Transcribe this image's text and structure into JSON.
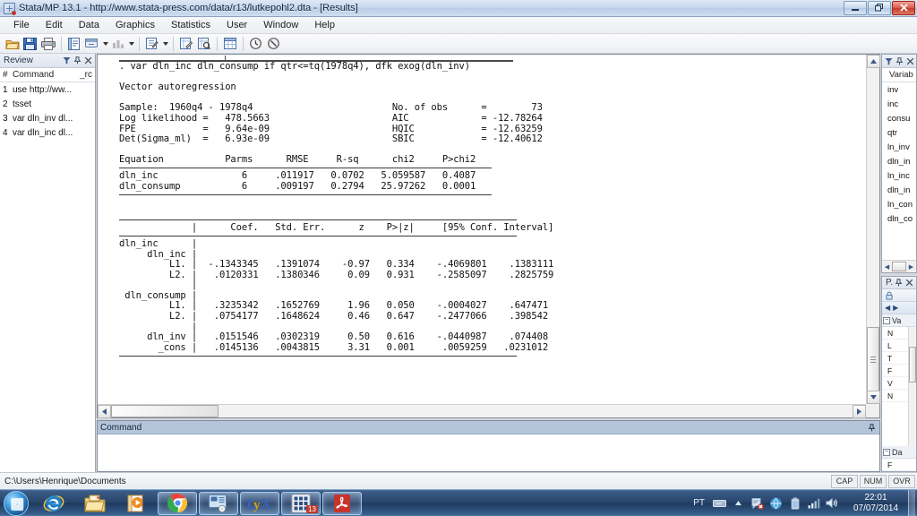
{
  "window": {
    "title": "Stata/MP 13.1 - http://www.stata-press.com/data/r13/lutkepohl2.dta - [Results]",
    "minimize_label": "–",
    "restore_label": "❐",
    "close_label": "✕"
  },
  "menu": {
    "items": [
      {
        "label": "File"
      },
      {
        "label": "Edit"
      },
      {
        "label": "Data"
      },
      {
        "label": "Graphics"
      },
      {
        "label": "Statistics"
      },
      {
        "label": "User"
      },
      {
        "label": "Window"
      },
      {
        "label": "Help"
      }
    ]
  },
  "toolbar": {
    "buttons": [
      {
        "name": "open-icon",
        "title": "Open"
      },
      {
        "name": "save-icon",
        "title": "Save"
      },
      {
        "name": "print-icon",
        "title": "Print"
      },
      {
        "name": "log-icon",
        "title": "Begin log"
      },
      {
        "name": "viewer-icon",
        "title": "Viewer"
      },
      {
        "name": "graph-icon",
        "title": "Bring graph window to front"
      },
      {
        "name": "do-editor-icon",
        "title": "New Do-file Editor"
      },
      {
        "name": "data-editor-icon",
        "title": "Data Editor (Edit)"
      },
      {
        "name": "data-browser-icon",
        "title": "Data Editor (Browse)"
      },
      {
        "name": "variables-manager-icon",
        "title": "Variables Manager"
      },
      {
        "name": "clock-icon",
        "title": "More"
      },
      {
        "name": "break-icon",
        "title": "Break"
      }
    ]
  },
  "review": {
    "title": "Review",
    "columns": {
      "num": "#",
      "command": "Command",
      "rc": "_rc"
    },
    "rows": [
      {
        "num": "1",
        "command": "use http://ww..."
      },
      {
        "num": "2",
        "command": "tsset"
      },
      {
        "num": "3",
        "command": "var dln_inv dl..."
      },
      {
        "num": "4",
        "command": "var dln_inc dl..."
      }
    ],
    "header_icons": [
      "filter-icon",
      "pin-icon",
      "close-icon"
    ]
  },
  "variables": {
    "title": "Variab",
    "column_header": "Variab",
    "items": [
      {
        "name": "inv"
      },
      {
        "name": "inc"
      },
      {
        "name": "consu"
      },
      {
        "name": "qtr"
      },
      {
        "name": "ln_inv"
      },
      {
        "name": "dln_in"
      },
      {
        "name": "ln_inc"
      },
      {
        "name": "dln_in"
      },
      {
        "name": "ln_con"
      },
      {
        "name": "dln_co"
      }
    ],
    "header_icons": [
      "filter-icon",
      "pin-icon",
      "close-icon"
    ]
  },
  "properties": {
    "title": "P...",
    "lock_icon": "lock-icon",
    "nav_back": "◀",
    "nav_forward": "▶",
    "groups": [
      {
        "label": "Va",
        "rows": [
          {
            "label": "N"
          },
          {
            "label": "L"
          },
          {
            "label": "T"
          },
          {
            "label": "F"
          },
          {
            "label": "V"
          },
          {
            "label": "N"
          }
        ]
      },
      {
        "label": "Da",
        "rows": [
          {
            "label": "F"
          }
        ]
      }
    ],
    "header_icons": [
      "pin-icon",
      "close-icon"
    ]
  },
  "command_window": {
    "title": "Command",
    "value": "",
    "placeholder": "",
    "pin_icon": "pin-icon"
  },
  "results": {
    "lines": [
      ". var dln_inc dln_consump if qtr<=tq(1978q4), dfk exog(dln_inv)",
      "",
      "Vector autoregression",
      "",
      "Sample:  1960q4 - 1978q4                         No. of obs      =        73",
      "Log likelihood =   478.5663                      AIC             = -12.78264",
      "FPE            =   9.64e-09                      HQIC            = -12.63259",
      "Det(Sigma_ml)  =   6.93e-09                      SBIC            = -12.40612",
      "",
      "Equation           Parms      RMSE     R-sq      chi2     P>chi2",
      "RULE_EQ_TOP",
      "dln_inc               6     .011917   0.0702   5.059587   0.4087",
      "dln_consump           6     .009197   0.2794   25.97262   0.0001",
      "RULE_EQ_BOT",
      "",
      "",
      "RULE_COEF_TOP",
      "             |      Coef.   Std. Err.      z    P>|z|     [95% Conf. Interval]",
      "RULE_COEF_MID",
      "dln_inc      |",
      "     dln_inc |",
      "         L1. |  -.1343345   .1391074    -0.97   0.334    -.4069801    .1383111",
      "         L2. |   .0120331   .1380346     0.09   0.931    -.2585097    .2825759",
      "             |",
      " dln_consump |",
      "         L1. |   .3235342   .1652769     1.96   0.050    -.0004027    .647471",
      "         L2. |   .0754177   .1648624     0.46   0.647    -.2477066    .398542",
      "             |",
      "     dln_inv |   .0151546   .0302319     0.50   0.616    -.0440987    .074408",
      "       _cons |   .0145136   .0043815     3.31   0.001     .0059259   .0231012",
      "RULE_COEF_BOT"
    ]
  },
  "statusbar": {
    "path": "C:\\Users\\Henrique\\Documents",
    "indicators": [
      {
        "label": "CAP"
      },
      {
        "label": "NUM"
      },
      {
        "label": "OVR"
      }
    ]
  },
  "taskbar": {
    "start_label": "Start",
    "tasks": [
      {
        "name": "internet-explorer-icon",
        "open": false
      },
      {
        "name": "file-explorer-icon",
        "open": false
      },
      {
        "name": "windows-media-player-icon",
        "open": false
      },
      {
        "name": "google-chrome-icon",
        "open": true
      },
      {
        "name": "control-panel-icon",
        "open": true
      },
      {
        "name": "lyx-icon",
        "open": true
      },
      {
        "name": "stata-icon",
        "open": true,
        "badge": "13"
      },
      {
        "name": "adobe-reader-icon",
        "open": true
      }
    ],
    "tray": {
      "language": "PT",
      "icons": [
        "keyboard-icon",
        "show-hidden-icon",
        "action-center-icon",
        "network-icon",
        "battery-icon",
        "signal-icon",
        "volume-icon"
      ],
      "time": "22:01",
      "date": "07/07/2014"
    }
  },
  "colors": {
    "accent": "#2b4a75",
    "titlebar": "#c8d8ee",
    "command_header": "#b4c5da",
    "close_button": "#c23b28",
    "taskbar": "#27436a"
  }
}
